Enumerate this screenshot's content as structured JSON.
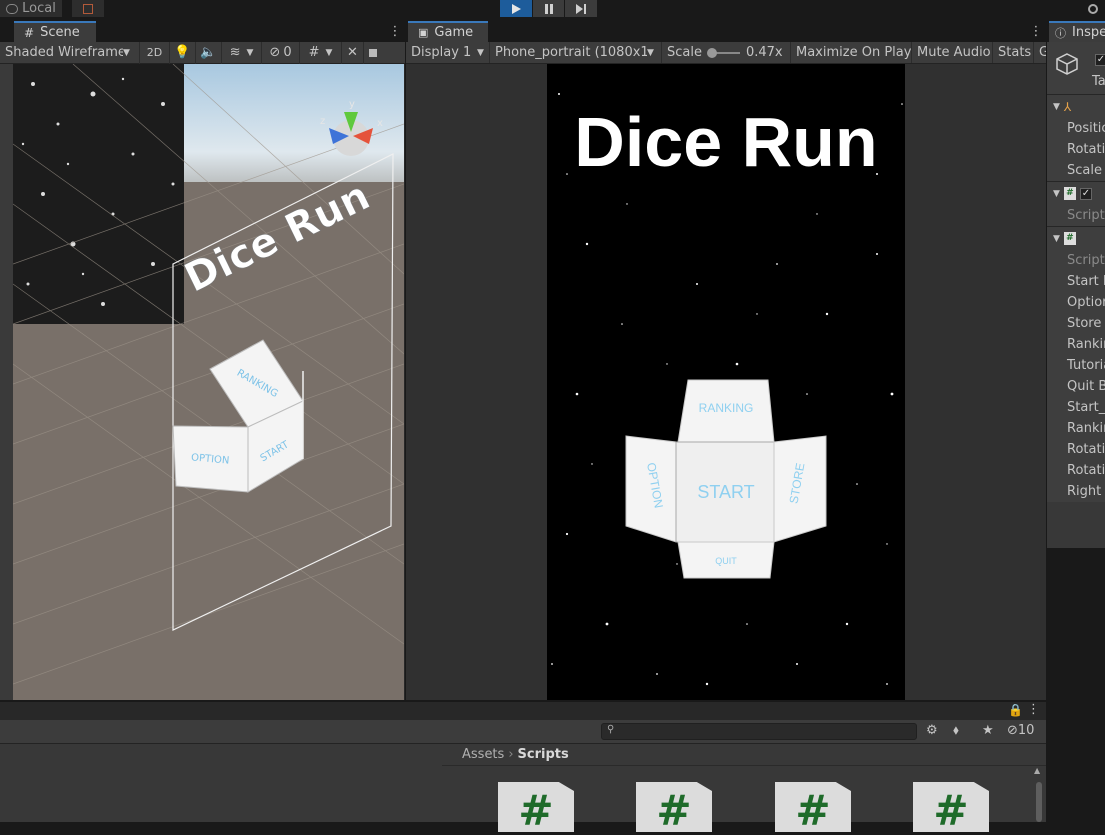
{
  "toolbar": {
    "account": "Local",
    "play_icon": "play-icon",
    "pause_icon": "pause-icon",
    "step_icon": "step-icon"
  },
  "scene": {
    "tab_label": "Scene",
    "shading_mode": "Shaded Wireframe",
    "toggle_2d": "2D",
    "hidden_count": "0",
    "gizmo_axes": {
      "x": "x",
      "y": "y",
      "z": "z"
    },
    "title_text": "Dice Run",
    "dice_faces": {
      "top": "RANKING",
      "left": "OPTION",
      "front": "START"
    }
  },
  "game": {
    "tab_label": "Game",
    "display": "Display 1",
    "resolution": "Phone_portrait (1080x19",
    "scale_label": "Scale",
    "scale_value": "0.47x",
    "maximize": "Maximize On Play",
    "mute": "Mute Audio",
    "stats": "Stats",
    "gizmos": "G",
    "title_text": "Dice Run",
    "dice_faces": {
      "top": "RANKING",
      "left": "OPTION",
      "center": "START",
      "right": "STORE",
      "bottom": "QUIT"
    }
  },
  "inspector": {
    "tab_label": "Inspe",
    "object_tag": "Ta",
    "transform_rows": [
      "Positic",
      "Rotatic",
      "Scale"
    ],
    "component1_rows": [
      "Script"
    ],
    "component2_rows": [
      "Script",
      "Start B",
      "Optior",
      "Store I",
      "Rankir",
      "Tutoria",
      "Quit B",
      "Start_F",
      "Rankir",
      "Rotatic",
      "Rotatic",
      "Right A"
    ]
  },
  "project": {
    "search_placeholder": "",
    "breadcrumb_root": "Assets",
    "breadcrumb_current": "Scripts",
    "hidden_count": "10",
    "file_glyph": "#",
    "colors": {
      "accent": "#3a79bb",
      "play_active": "#1d5c9b",
      "script_icon": "#1f6b2a"
    }
  }
}
